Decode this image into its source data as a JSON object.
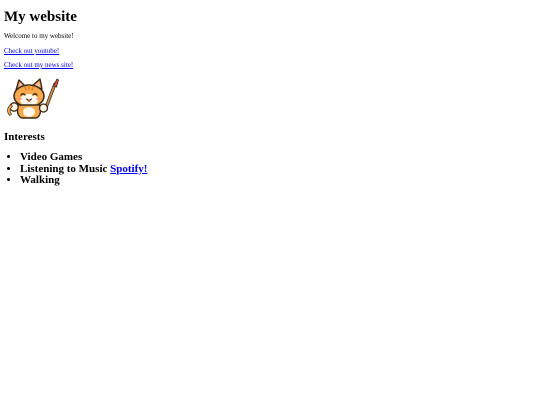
{
  "page": {
    "title": "My website",
    "welcome_text": "Welcome to my website!",
    "links": {
      "youtube": "Check out youtube!",
      "news": "Check out my news site!"
    },
    "image": {
      "alt": "cartoon cat with paintbrush",
      "icon": "cat-mascot"
    },
    "interests_heading": "Interests",
    "interests": [
      {
        "label": "Video Games"
      },
      {
        "label": "Listening to Music",
        "link_label": "Spotify!"
      },
      {
        "label": "Walking"
      }
    ]
  },
  "colors": {
    "link": "#0000ee",
    "text": "#000000",
    "background": "#ffffff",
    "mascot_orange": "#f5a94a",
    "mascot_outline": "#3a2a1a"
  }
}
